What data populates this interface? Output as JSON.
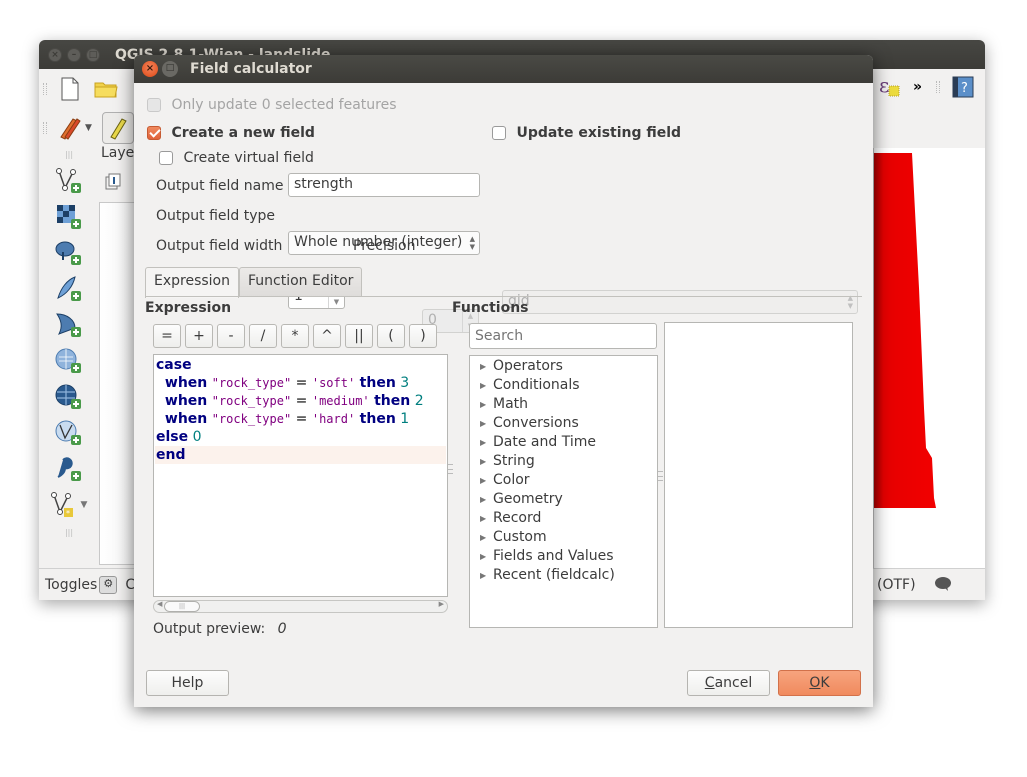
{
  "background_window": {
    "title": "QGIS 2.8.1-Wien - landslide",
    "layers_panel_title": "Laye",
    "statusbar": {
      "left_text": "Toggles",
      "middle_text": "C",
      "crs_text": "(OTF)"
    },
    "map_fill_color": "#ee0000",
    "toolbar_icons": [
      "new-project-icon",
      "open-project-icon",
      "digitize-pencils-icon",
      "toggle-editing-icon",
      "expression-select-icon",
      "help-icon"
    ],
    "side_tools": [
      "add-vector-layer",
      "add-raster-layer",
      "add-postgis-layer",
      "add-spatialite-layer",
      "add-mssql-layer",
      "add-wms-layer",
      "add-wcs-layer",
      "add-wfs-layer",
      "add-delimited-text-layer",
      "new-shapefile-layer"
    ]
  },
  "dialog": {
    "title": "Field calculator",
    "only_update_selected": {
      "label": "Only update 0 selected features",
      "checked": false,
      "enabled": false
    },
    "create_new_field": {
      "label": "Create a new field",
      "checked": true
    },
    "update_existing_field": {
      "label": "Update existing field",
      "checked": false
    },
    "create_virtual_field": {
      "label": "Create virtual field",
      "checked": false
    },
    "output_field_name": {
      "label": "Output field name",
      "value": "strength"
    },
    "output_field_type": {
      "label": "Output field type",
      "value": "Whole number (integer)"
    },
    "output_field_width": {
      "label": "Output field width",
      "value": "1"
    },
    "precision": {
      "label": "Precision",
      "value": "0"
    },
    "existing_field_combo": {
      "value": "gid"
    },
    "tabs": [
      {
        "label": "Expression",
        "active": true
      },
      {
        "label": "Function Editor",
        "active": false
      }
    ],
    "expression_heading": "Expression",
    "functions_heading": "Functions",
    "operator_buttons": [
      "=",
      "+",
      "-",
      "/",
      "*",
      "^",
      "||",
      "(",
      ")"
    ],
    "expression_lines": [
      [
        {
          "t": "kw",
          "v": "case"
        }
      ],
      [
        {
          "t": "sp",
          "v": "  "
        },
        {
          "t": "kw",
          "v": "when"
        },
        {
          "t": "sp",
          "v": " "
        },
        {
          "t": "fld",
          "v": "\"rock_type\""
        },
        {
          "t": "sp",
          "v": " "
        },
        {
          "t": "op",
          "v": "="
        },
        {
          "t": "sp",
          "v": " "
        },
        {
          "t": "str",
          "v": "'soft'"
        },
        {
          "t": "sp",
          "v": " "
        },
        {
          "t": "kw",
          "v": "then"
        },
        {
          "t": "sp",
          "v": " "
        },
        {
          "t": "num",
          "v": "3"
        }
      ],
      [
        {
          "t": "sp",
          "v": "  "
        },
        {
          "t": "kw",
          "v": "when"
        },
        {
          "t": "sp",
          "v": " "
        },
        {
          "t": "fld",
          "v": "\"rock_type\""
        },
        {
          "t": "sp",
          "v": " "
        },
        {
          "t": "op",
          "v": "="
        },
        {
          "t": "sp",
          "v": " "
        },
        {
          "t": "str",
          "v": "'medium'"
        },
        {
          "t": "sp",
          "v": " "
        },
        {
          "t": "kw",
          "v": "then"
        },
        {
          "t": "sp",
          "v": " "
        },
        {
          "t": "num",
          "v": "2"
        }
      ],
      [
        {
          "t": "sp",
          "v": "  "
        },
        {
          "t": "kw",
          "v": "when"
        },
        {
          "t": "sp",
          "v": " "
        },
        {
          "t": "fld",
          "v": "\"rock_type\""
        },
        {
          "t": "sp",
          "v": " "
        },
        {
          "t": "op",
          "v": "="
        },
        {
          "t": "sp",
          "v": " "
        },
        {
          "t": "str",
          "v": "'hard'"
        },
        {
          "t": "sp",
          "v": " "
        },
        {
          "t": "kw",
          "v": "then"
        },
        {
          "t": "sp",
          "v": " "
        },
        {
          "t": "num",
          "v": "1"
        }
      ],
      [
        {
          "t": "kw",
          "v": "else"
        },
        {
          "t": "sp",
          "v": " "
        },
        {
          "t": "num",
          "v": "0"
        }
      ],
      [
        {
          "t": "kw",
          "v": "end"
        }
      ]
    ],
    "search_placeholder": "Search",
    "function_groups": [
      "Operators",
      "Conditionals",
      "Math",
      "Conversions",
      "Date and Time",
      "String",
      "Color",
      "Geometry",
      "Record",
      "Custom",
      "Fields and Values",
      "Recent (fieldcalc)"
    ],
    "output_preview_label": "Output preview:",
    "output_preview_value": "0",
    "buttons": {
      "help": "Help",
      "cancel": "Cancel",
      "ok": "OK"
    },
    "accent_color": "#f08a5e"
  }
}
